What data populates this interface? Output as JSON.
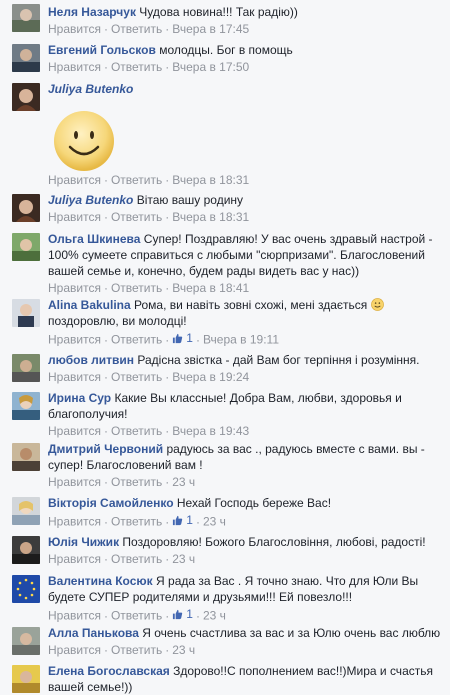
{
  "labels": {
    "like": "Нравится",
    "reply": "Ответить",
    "sep": "·"
  },
  "comments": [
    {
      "author": "Неля Назарчук",
      "text": "Чудова новина!!! Так радію))",
      "time": "Вчера в 17:45",
      "likes": ""
    },
    {
      "author": "Евгений Гольсков",
      "text": "молодцы. Бог в помощь",
      "time": "Вчера в 17:50",
      "likes": ""
    },
    {
      "author": "Juliya Butenko",
      "text": "",
      "time": "Вчера в 18:31",
      "likes": ""
    },
    {
      "author": "Juliya Butenko",
      "text": "Вітаю вашу родину",
      "time": "Вчера в 18:31",
      "likes": ""
    },
    {
      "author": "Ольга Шкинева",
      "text": "Супер! Поздравляю! У вас очень здравый настрой - 100% сумеете справиться с любыми \"сюрпризами\". Благословений вашей семье и, конечно, будем рады видеть вас у нас))",
      "time": "Вчера в 18:41",
      "likes": ""
    },
    {
      "author": "Alina Bakulina",
      "text_a": "Рома, ви навіть зовні схожі, мені здається",
      "text_b": "поздоровлю, ви молодці!",
      "time": "Вчера в 19:11",
      "likes": "1"
    },
    {
      "author": "любов литвин",
      "text": "Радісна звістка - дай Вам бог терпіння і розуміння.",
      "time": "Вчера в 19:24",
      "likes": ""
    },
    {
      "author": "Ирина Сур",
      "text": "Какие Вы классные! Добра Вам, любви, здоровья и благополучия!",
      "time": "Вчера в 19:43",
      "likes": ""
    },
    {
      "author": "Дмитрий Червоний",
      "text": "радуюсь за вас ., радуюсь вместе с вами. вы - супер! Благословений вам !",
      "time": "23 ч",
      "likes": ""
    },
    {
      "author": "Вікторія Самойленко",
      "text": "Нехай Господь береже Вас!",
      "time": "23 ч",
      "likes": "1"
    },
    {
      "author": "Юлія Чижик",
      "text": "Поздоровляю! Божого Благословіння, любові, радості!",
      "time": "23 ч",
      "likes": ""
    },
    {
      "author": "Валентина Косюк",
      "text": "Я рада за Вас . Я точно знаю. Что для Юли Вы будете СУПЕР родителями и друзьями!!! Ей повезло!!!",
      "time": "23 ч",
      "likes": "1"
    },
    {
      "author": "Алла Панькова",
      "text": "Я очень счастлива за вас и за Юлю очень вас люблю",
      "time": "23 ч",
      "likes": ""
    },
    {
      "author": "Елена Богославская",
      "text": "Здорово!!С пополнением вас!!)Мира и счастья вашей семье!))",
      "time": "",
      "likes": ""
    }
  ]
}
